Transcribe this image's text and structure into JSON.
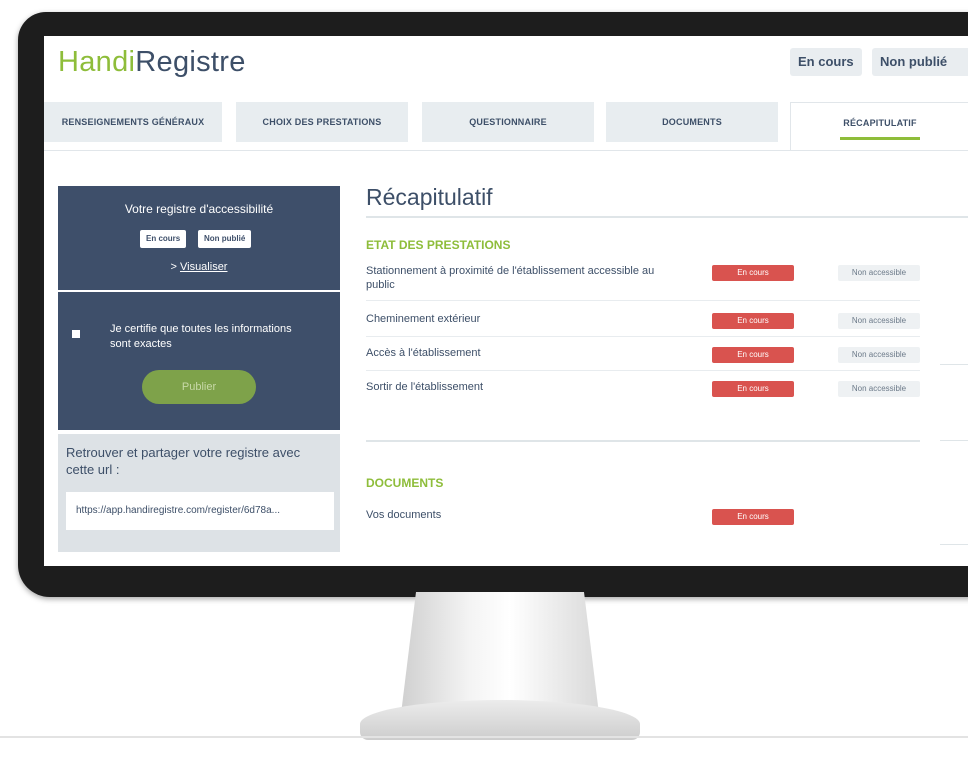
{
  "app": {
    "logo_part1": "Handi",
    "logo_part2": "Registre",
    "badge_status": "En cours",
    "badge_publication": "Non publié"
  },
  "tabs": [
    {
      "label": "RENSEIGNEMENTS GÉNÉRAUX"
    },
    {
      "label": "CHOIX DES PRESTATIONS"
    },
    {
      "label": "QUESTIONNAIRE"
    },
    {
      "label": "DOCUMENTS"
    },
    {
      "label": "RÉCAPITULATIF"
    }
  ],
  "sidebar": {
    "registry_title": "Votre registre d'accessibilité",
    "status_badge": "En cours",
    "publication_badge": "Non publié",
    "visualiser_prefix": "> ",
    "visualiser_link": "Visualiser",
    "certify_text": "Je certifie que toutes les informations sont exactes",
    "publish_button": "Publier",
    "share_text": "Retrouver et partager votre registre avec cette url :",
    "share_url": "https://app.handiregistre.com/register/6d78a..."
  },
  "main": {
    "title": "Récapitulatif",
    "section_prestations": "ETAT DES PRESTATIONS",
    "prestations": [
      {
        "label": "Stationnement à proximité de l'établissement accessible au public",
        "status": "En cours",
        "accessibility": "Non accessible"
      },
      {
        "label": "Cheminement extérieur",
        "status": "En cours",
        "accessibility": "Non accessible"
      },
      {
        "label": "Accès à l'établissement",
        "status": "En cours",
        "accessibility": "Non accessible"
      },
      {
        "label": "Sortir de l'établissement",
        "status": "En cours",
        "accessibility": "Non accessible"
      }
    ],
    "section_documents": "DOCUMENTS",
    "documents_row": {
      "label": "Vos documents",
      "status": "En cours"
    }
  },
  "colors": {
    "brand_green": "#8ebd3a",
    "navy": "#3e4f6a",
    "status_red": "#d9534f"
  }
}
